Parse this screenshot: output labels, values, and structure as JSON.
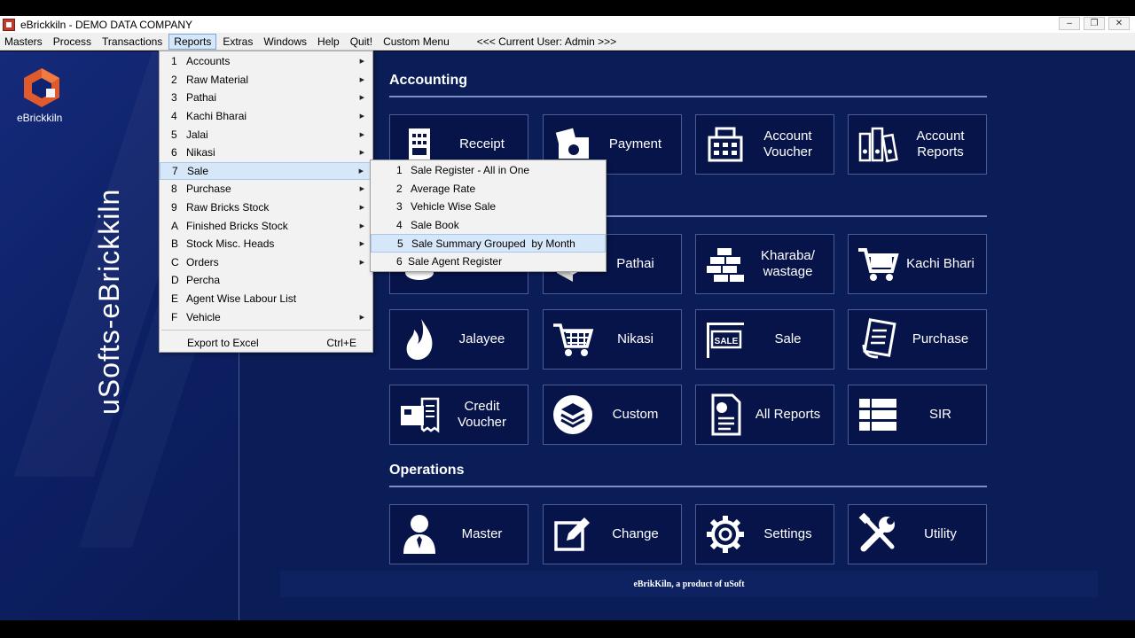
{
  "window": {
    "title": "eBrickkiln - DEMO DATA COMPANY",
    "controls": [
      "–",
      "❐",
      "✕"
    ]
  },
  "menubar": {
    "items": [
      "Masters",
      "Process",
      "Transactions",
      "Reports",
      "Extras",
      "Windows",
      "Help",
      "Quit!",
      "Custom Menu"
    ],
    "active": "Reports",
    "info": "<<<  Current User: Admin >>>"
  },
  "sidebar": {
    "logo_text": "eBrickkiln",
    "brand_vertical": "uSofts-eBrickkiln"
  },
  "sections": {
    "accounting": "Accounting",
    "operations": "Operations"
  },
  "tiles": {
    "receipt": "Receipt",
    "payment": "Payment",
    "account_voucher": "Account Voucher",
    "account_reports": "Account Reports",
    "pathai": "Pathai",
    "kharaba": "Kharaba/ wastage",
    "kachi_bhari": "Kachi Bhari",
    "jalayee": "Jalayee",
    "nikasi": "Nikasi",
    "sale": "Sale",
    "purchase": "Purchase",
    "credit_voucher": "Credit Voucher",
    "custom": "Custom",
    "all_reports": "All Reports",
    "sir": "SIR",
    "master": "Master",
    "change": "Change",
    "settings": "Settings",
    "utility": "Utility"
  },
  "sale_badge": "SALE",
  "footer": "eBrikKiln, a product of uSoft",
  "reports_menu": {
    "items": [
      {
        "key": "1",
        "label": "Accounts",
        "submenu": true
      },
      {
        "key": "2",
        "label": "Raw Material",
        "submenu": true
      },
      {
        "key": "3",
        "label": "Pathai",
        "submenu": true
      },
      {
        "key": "4",
        "label": "Kachi Bharai",
        "submenu": true
      },
      {
        "key": "5",
        "label": "Jalai",
        "submenu": true
      },
      {
        "key": "6",
        "label": "Nikasi",
        "submenu": true
      },
      {
        "key": "7",
        "label": "Sale",
        "submenu": true
      },
      {
        "key": "8",
        "label": "Purchase",
        "submenu": true
      },
      {
        "key": "9",
        "label": "Raw Bricks Stock",
        "submenu": true
      },
      {
        "key": "A",
        "label": "Finished Bricks Stock",
        "submenu": true
      },
      {
        "key": "B",
        "label": "Stock Misc. Heads",
        "submenu": true
      },
      {
        "key": "C",
        "label": "Orders",
        "submenu": true
      },
      {
        "key": "D",
        "label": "Percha",
        "submenu": false
      },
      {
        "key": "E",
        "label": "Agent Wise Labour List",
        "submenu": false
      },
      {
        "key": "F",
        "label": "Vehicle",
        "submenu": true
      }
    ],
    "highlighted": "Sale",
    "export_label": "Export to Excel",
    "export_shortcut": "Ctrl+E"
  },
  "sale_submenu": {
    "items": [
      {
        "key": "1",
        "label": "Sale Register - All in One"
      },
      {
        "key": "2",
        "label": "Average Rate"
      },
      {
        "key": "3",
        "label": "Vehicle Wise Sale"
      },
      {
        "key": "4",
        "label": "Sale Book"
      },
      {
        "key": "5",
        "label": "Sale Summary Grouped  by Month"
      },
      {
        "key": "6",
        "label": "Sale Agent Register"
      }
    ],
    "highlighted": "Sale Summary Grouped  by Month"
  },
  "colors": {
    "background": "#0a1d57",
    "tile": "#07144a",
    "tile_border": "#4a5b97",
    "menu_highlight": "#d6e7f9",
    "logo": "#e05a2b"
  }
}
